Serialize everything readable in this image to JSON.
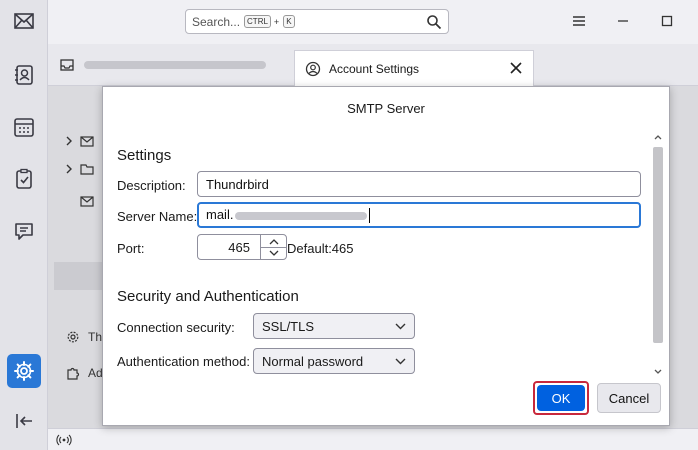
{
  "search": {
    "placeholder": "Search...",
    "shortcut_key1": "CTRL",
    "shortcut_plus": "+",
    "shortcut_key2": "K"
  },
  "tabs": [
    {
      "label": "Account Settings"
    }
  ],
  "background_pane": {
    "items": [
      {
        "label": ""
      },
      {
        "label": ""
      }
    ],
    "bottom_items": [
      {
        "label": "Th"
      },
      {
        "label": "Ad"
      }
    ]
  },
  "dialog": {
    "title": "SMTP Server",
    "settings_heading": "Settings",
    "description_label": "Description:",
    "description_value": "Thundrbird",
    "server_name_label": "Server Name:",
    "server_name_value": "mail.",
    "port_label": "Port:",
    "port_value": "465",
    "port_default": "Default:465",
    "security_heading": "Security and Authentication",
    "connection_security_label": "Connection security:",
    "connection_security_value": "SSL/TLS",
    "auth_method_label": "Authentication method:",
    "auth_method_value": "Normal password",
    "ok_label": "OK",
    "cancel_label": "Cancel"
  },
  "colors": {
    "accent": "#0061e0",
    "highlight_border": "#c8283c",
    "active_space": "#2a78d6"
  }
}
